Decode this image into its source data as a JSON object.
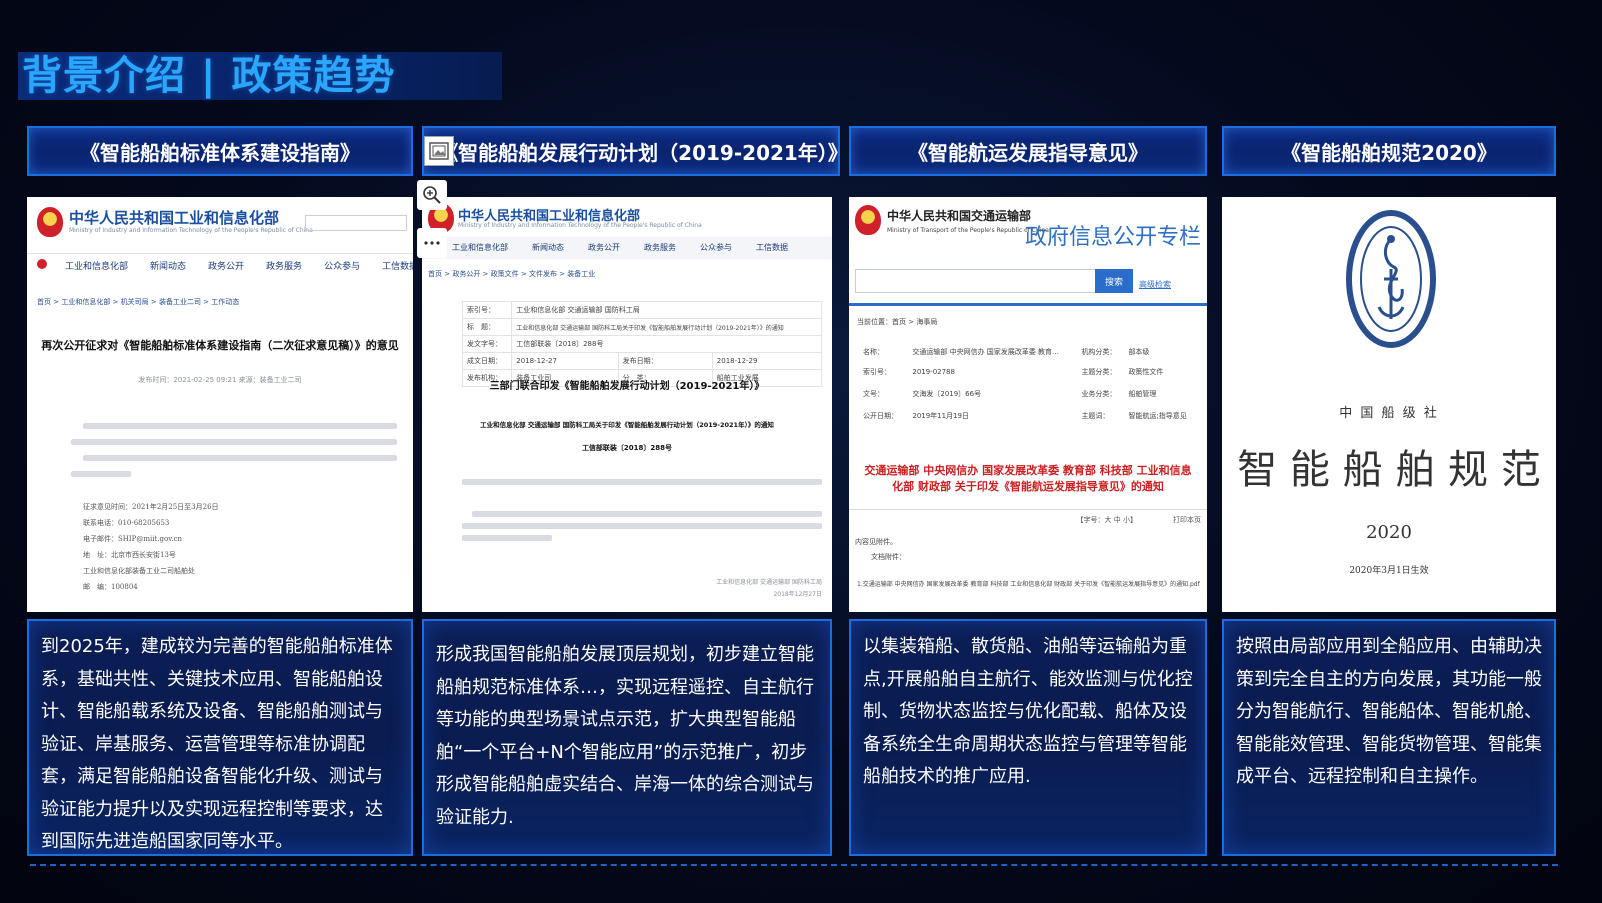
{
  "slide": {
    "title": "背景介绍 | 政策趋势"
  },
  "columns": [
    {
      "header": "《智能船舶标准体系建设指南》",
      "doc": {
        "site_name": "中华人民共和国工业和信息化部",
        "site_sub": "Ministry of Industry and Information Technology of the People's Republic of China",
        "nav": [
          "工业和信息化部",
          "新闻动态",
          "政务公开",
          "政务服务",
          "公众参与",
          "工信数据"
        ],
        "breadcrumb": "首页 > 工业和信息化部 > 机关司局 > 装备工业二司 > 工作动态",
        "heading": "再次公开征求对《智能船舶标准体系建设指南（二次征求意见稿）》的意见",
        "dateline": "发布时间：2021-02-25 09:21   来源：装备工业二司",
        "contact": [
          "征求意见时间：2021年2月25日至3月26日",
          "联系电话：010-68205653",
          "电子邮件：SHIP@miit.gov.cn",
          "地　址：北京市西长安街13号",
          "工业和信息化部装备工业二司船舶处",
          "邮　编：100804"
        ]
      },
      "description": "到2025年，建成较为完善的智能船舶标准体系，基础共性、关键技术应用、智能船舶设计、智能船载系统及设备、智能船舶测试与验证、岸基服务、运营管理等标准协调配套，满足智能船舶设备智能化升级、测试与验证能力提升以及实现远程控制等要求，达到国际先进造船国家同等水平。"
    },
    {
      "header": "《智能船舶发展行动计划（2019-2021年）》",
      "doc": {
        "site_name": "中华人民共和国工业和信息化部",
        "site_sub": "Ministry of Industry and Information Technology of the People's Republic of China",
        "nav": [
          "工业和信息化部",
          "新闻动态",
          "政务公开",
          "政务服务",
          "公众参与",
          "工信数据"
        ],
        "breadcrumb": "首页 > 政务公开 > 政策文件 > 文件发布 > 装备工业",
        "meta": [
          [
            "索引号：",
            "工业和信息化部 交通运输部 国防科工局"
          ],
          [
            "标　题：",
            "工业和信息化部 交通运输部 国防科工局关于印发《智能船舶发展行动计划（2019-2021年）》的通知"
          ],
          [
            "发文字号：",
            "工信部联装〔2018〕288号"
          ],
          [
            "成文日期：",
            "2018-12-27",
            "发布日期：",
            "2018-12-29"
          ],
          [
            "发布机构：",
            "装备工业司",
            "分　类：",
            "船舶工业发展"
          ]
        ],
        "heading": "三部门联合印发《智能船舶发展行动计划（2019-2021年）》",
        "subheading": "工业和信息化部 交通运输部 国防科工局关于印发《智能船舶发展行动计划（2019-2021年）》的通知",
        "doc_no": "工信部联装〔2018〕288号",
        "signature": "工业和信息化部 交通运输部 国防科工局",
        "sig_date": "2018年12月27日"
      },
      "description": "形成我国智能船舶发展顶层规划，初步建立智能船舶规范标准体系…，实现远程遥控、自主航行等功能的典型场景试点示范，扩大典型智能船舶“一个平台+N个智能应用”的示范推广，初步形成智能船舶虚实结合、岸海一体的综合测试与验证能力."
    },
    {
      "header": "《智能航运发展指导意见》",
      "doc": {
        "site_name": "中华人民共和国交通运输部",
        "site_sub": "Ministry of Transport of the People's Republic of China",
        "column_title": "政府信息公开专栏",
        "search_label": "搜索",
        "advanced_search": "高级检索",
        "location": "当前位置：首页 > 海事局",
        "meta": [
          [
            "名称：",
            "交通运输部 中央网信办 国家发展改革委 教育…",
            "机构分类：",
            "部本级"
          ],
          [
            "索引号：",
            "2019-02788",
            "主题分类：",
            "政策性文件"
          ],
          [
            "文号：",
            "交海发〔2019〕66号",
            "业务分类：",
            "船舶管理"
          ],
          [
            "公开日期：",
            "2019年11月19日",
            "主题词：",
            "智能航运;指导意见"
          ]
        ],
        "heading": "交通运输部 中央网信办 国家发展改革委 教育部 科技部 工业和信息化部 财政部 关于印发《智能航运发展指导意见》的通知",
        "font_ctrl": "【字号：大 中 小】",
        "print": "打印本页",
        "related_label": "内容见附件。",
        "attachment_label": "文档附件：",
        "attachment": "1.交通运输部 中央网信办 国家发展改革委 教育部 科技部 工业和信息化部 财政部 关于印发《智能航运发展指导意见》的通知.pdf"
      },
      "description": "以集装箱船、散货船、油船等运输船为重点,开展船舶自主航行、能效监测与优化控制、货物状态监控与优化配载、船体及设备系统全生命周期状态监控与管理等智能船舶技术的推广应用."
    },
    {
      "header": "《智能船舶规范2020》",
      "doc": {
        "seal_text": "CHINA CLASSIFICATION SOCIETY",
        "seal_top": "中国船级社",
        "org": "中 国 船 级 社",
        "title": "智 能 船 舶 规 范",
        "year": "2020",
        "effective": "2020年3月1日生效"
      },
      "description": "按照由局部应用到全船应用、由辅助决策到完全自主的方向发展，其功能一般分为智能航行、智能船体、智能机舱、智能能效管理、智能货物管理、智能集成平台、远程控制和自主操作。"
    },
    {
      "colors": {
        "title": "#2aa6ff",
        "border": "#1a6fe0",
        "header_bg": "#0d2c86",
        "body_bg": "#04091c",
        "seal": "#2a4f8f"
      }
    }
  ]
}
